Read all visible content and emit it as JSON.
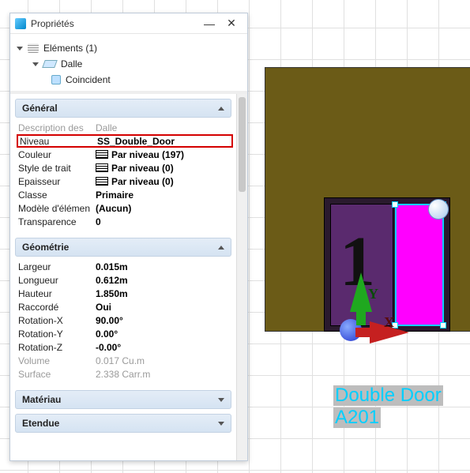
{
  "panel": {
    "title": "Propriétés",
    "tree": {
      "root": "Eléments (1)",
      "child": "Dalle",
      "grandchild": "Coincident"
    },
    "sections": {
      "general": {
        "title": "Général",
        "rows": {
          "desc_label": "Description des",
          "desc_value": "Dalle",
          "niveau_label": "Niveau",
          "niveau_value": "SS_Double_Door",
          "couleur_label": "Couleur",
          "couleur_value": "Par niveau (197)",
          "style_label": "Style de trait",
          "style_value": "Par niveau (0)",
          "epaisseur_label": "Epaisseur",
          "epaisseur_value": "Par niveau (0)",
          "classe_label": "Classe",
          "classe_value": "Primaire",
          "modele_label": "Modèle d'élémen",
          "modele_value": "(Aucun)",
          "transp_label": "Transparence",
          "transp_value": "0"
        }
      },
      "geometrie": {
        "title": "Géométrie",
        "rows": {
          "largeur_label": "Largeur",
          "largeur_value": "0.015m",
          "longueur_label": "Longueur",
          "longueur_value": "0.612m",
          "hauteur_label": "Hauteur",
          "hauteur_value": "1.850m",
          "raccorde_label": "Raccordé",
          "raccorde_value": "Oui",
          "rotx_label": "Rotation-X",
          "rotx_value": "90.00°",
          "roty_label": "Rotation-Y",
          "roty_value": "0.00°",
          "rotz_label": "Rotation-Z",
          "rotz_value": "-0.00°",
          "volume_label": "Volume",
          "volume_value": "0.017  Cu.m",
          "surface_label": "Surface",
          "surface_value": "2.338 Carr.m"
        }
      },
      "materiau": {
        "title": "Matériau"
      },
      "etendue": {
        "title": "Etendue"
      }
    }
  },
  "viewport": {
    "big_number": "1",
    "axis_y": "Y",
    "axis_x": "X",
    "label_line1": "Double Door",
    "label_line2": "A201"
  }
}
